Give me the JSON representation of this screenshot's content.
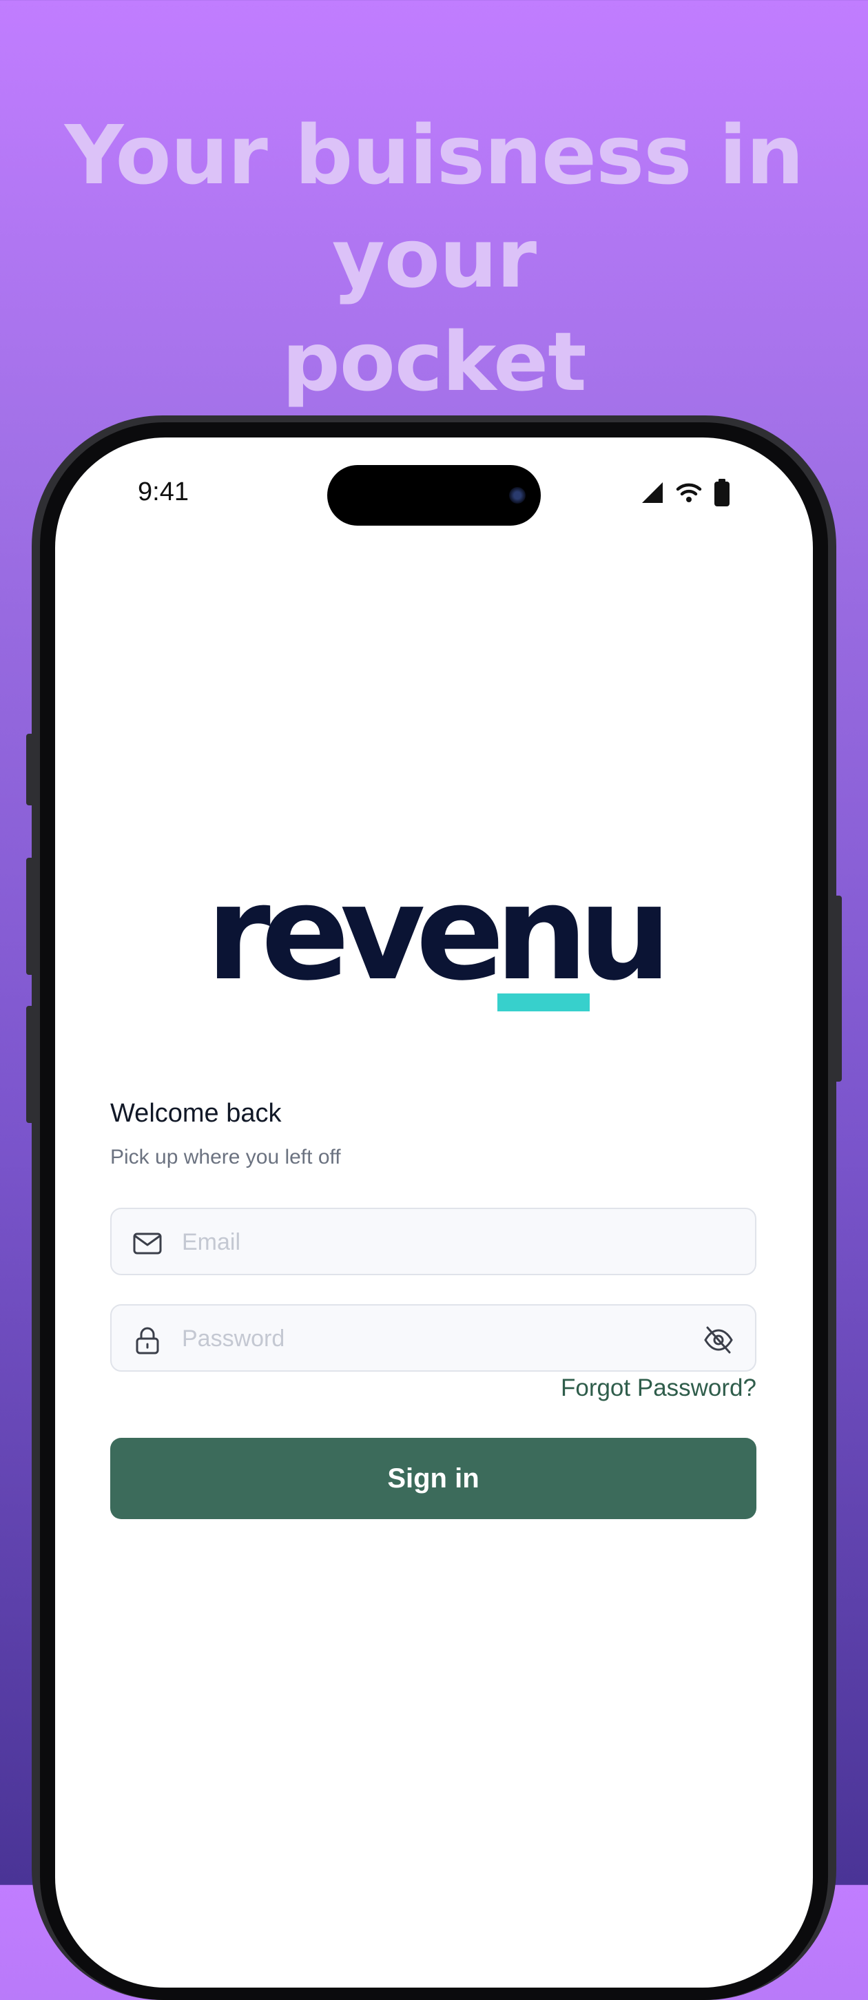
{
  "headline": {
    "line1": "Your buisness in your",
    "line2": "pocket"
  },
  "status_bar": {
    "time": "9:41"
  },
  "brand": {
    "logo_text": "revenu",
    "logo_color": "#0b1434",
    "accent_color": "#37d0cc"
  },
  "login": {
    "title": "Welcome back",
    "subtitle": "Pick up where you left off",
    "email": {
      "placeholder": "Email",
      "value": "",
      "icon": "mail-icon"
    },
    "password": {
      "placeholder": "Password",
      "value": "",
      "icon": "lock-icon",
      "toggle_icon": "eye-off-icon"
    },
    "forgot_label": "Forgot Password?",
    "signin_label": "Sign in",
    "button_color": "#3c6b5b"
  }
}
